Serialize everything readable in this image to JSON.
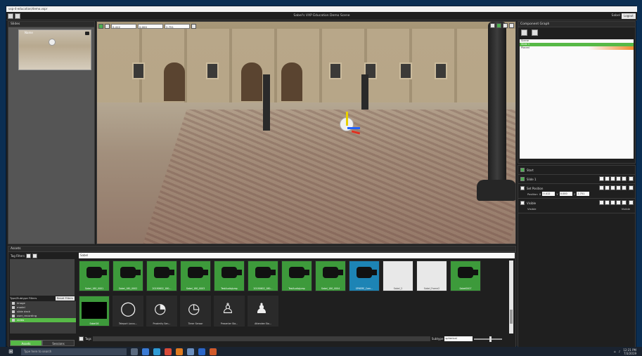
{
  "window": {
    "title": "Sabel's VXP Education Demo Scene",
    "path": "vxp-4-education/demo.vxpr",
    "user": "Sabel",
    "logout_label": "Logout"
  },
  "slides": {
    "header": "Slides",
    "slide_name": "Name"
  },
  "viewport": {
    "fields": [
      "0.412",
      "0.000",
      "2.751"
    ],
    "gizmo_colors": {
      "x": "#2060ff",
      "y": "#e8d000",
      "z": "#e03020"
    }
  },
  "component_graph": {
    "header": "Component Graph",
    "rows": [
      {
        "label": "Scene",
        "state": "normal"
      },
      {
        "label": "Slide 1",
        "state": "selected"
      },
      {
        "label": "Placed",
        "state": "orange"
      }
    ]
  },
  "properties": {
    "start": {
      "label": "Start"
    },
    "slide": {
      "label": "Slide 1"
    },
    "set_position": {
      "label": "Set Position",
      "position_label": "Position",
      "x_label": "X",
      "y_label": "Y",
      "z_label": "Z",
      "x": "0.412",
      "y": "0.000",
      "z": "2.751"
    },
    "visible": {
      "label": "Visible",
      "row_label": "Visible",
      "row_value_label": "Visible"
    }
  },
  "assets": {
    "header": "Assets",
    "tag_filters_label": "Tag Filters",
    "type_filters_label": "Type/Subtype Filters",
    "reset_filters_label": "Reset Filters",
    "type_items": [
      {
        "label": "image",
        "selected": false
      },
      {
        "label": "model",
        "selected": false
      },
      {
        "label": "slide deck",
        "selected": false
      },
      {
        "label": "user_recording",
        "selected": false
      },
      {
        "label": "video",
        "selected": true
      }
    ],
    "search_value": "Sabel",
    "tiles_row1": [
      {
        "label": "Sabel_180_0001",
        "style": "cam"
      },
      {
        "label": "Sabel_180_0002",
        "style": "cam"
      },
      {
        "label": "20190602_180...",
        "style": "cam"
      },
      {
        "label": "Sabel_180_0003",
        "style": "cam"
      },
      {
        "label": "TestAudioJump",
        "style": "cam"
      },
      {
        "label": "20190602_180...",
        "style": "cam"
      },
      {
        "label": "TestAudioJump",
        "style": "cam"
      },
      {
        "label": "Sabel_180_0004",
        "style": "cam"
      },
      {
        "label": "SPHERE_Cam...",
        "style": "blue"
      },
      {
        "label": "Sabel_2",
        "style": "white"
      },
      {
        "label": "Sabel_Frame2",
        "style": "white"
      },
      {
        "label": "Sabel0007",
        "style": "cam"
      }
    ],
    "tiles_row2": [
      {
        "label": "Sabel16",
        "style": "selbig"
      },
      {
        "label": "Teleport Locus...",
        "style": "dark",
        "glyph": "◯"
      },
      {
        "label": "Proximity Sen...",
        "style": "dark",
        "glyph": "◔"
      },
      {
        "label": "Timer Sensor",
        "style": "dark",
        "glyph": "◷"
      },
      {
        "label": "Presenter Sta...",
        "style": "dark",
        "glyph": "♙"
      },
      {
        "label": "Attendee Sta...",
        "style": "dark",
        "glyph": "♟"
      }
    ],
    "tags_label": "Tags",
    "subtype_label": "Subtype",
    "subtype_value": "spherical",
    "tabs": [
      {
        "label": "Assets",
        "active": true
      },
      {
        "label": "Sessions",
        "active": false
      }
    ]
  },
  "taskbar": {
    "search_placeholder": "Type here to search",
    "time": "12:21 PM",
    "date": "7/3/2019"
  }
}
